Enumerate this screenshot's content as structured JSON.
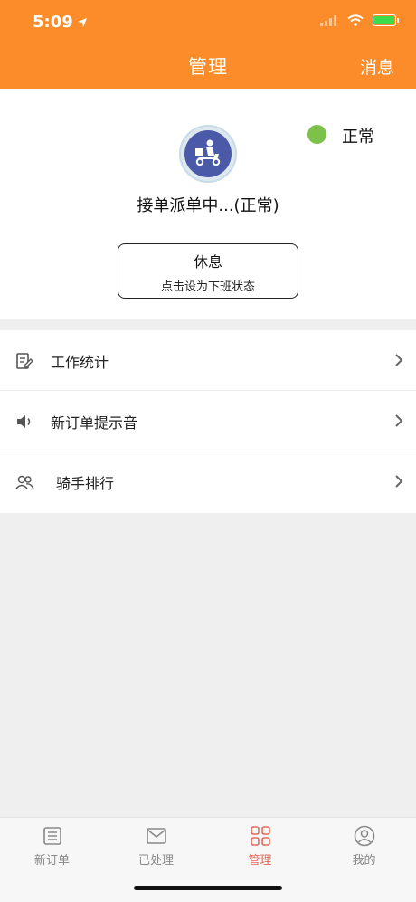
{
  "statusbar": {
    "time": "5:09"
  },
  "header": {
    "title": "管理",
    "right_action": "消息"
  },
  "status": {
    "label": "正常",
    "color": "#7dc04a"
  },
  "card": {
    "title": "接单派单中...(正常)",
    "rest_button": {
      "line1": "休息",
      "line2": "点击设为下班状态"
    }
  },
  "menu": {
    "items": [
      {
        "label": "工作统计",
        "icon": "edit-document-icon"
      },
      {
        "label": "新订单提示音",
        "icon": "speaker-icon"
      },
      {
        "label": "骑手排行",
        "icon": "users-icon"
      }
    ]
  },
  "tabbar": {
    "items": [
      {
        "label": "新订单",
        "icon": "list-icon",
        "active": false
      },
      {
        "label": "已处理",
        "icon": "mail-check-icon",
        "active": false
      },
      {
        "label": "管理",
        "icon": "grid-icon",
        "active": true
      },
      {
        "label": "我的",
        "icon": "profile-icon",
        "active": false
      }
    ],
    "active_color": "#e36a5a"
  },
  "colors": {
    "brand": "#fb8c29",
    "background": "#efefef"
  }
}
